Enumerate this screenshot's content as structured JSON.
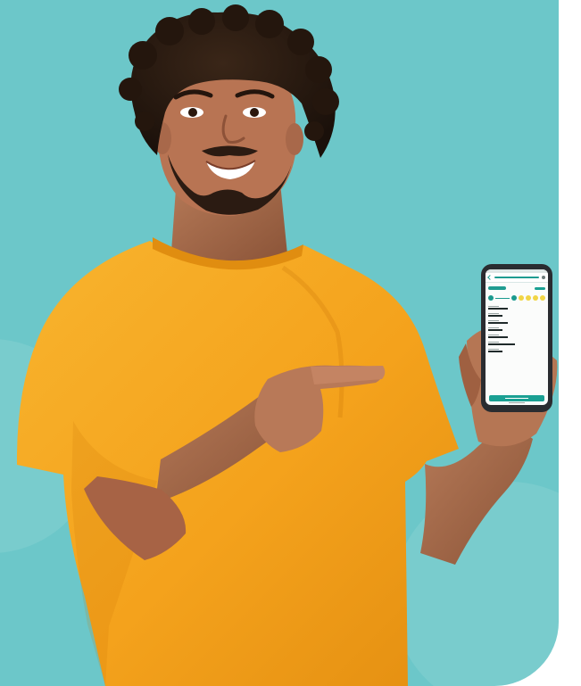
{
  "image": {
    "background_color": "#6cc7c9",
    "page_color": "#ffffff",
    "shirt_color": "#f5a623",
    "skin_color": "#a96b4d",
    "hair_color": "#2a1a10",
    "phone_frame_color": "#2a2c30",
    "phone_accent_color": "#1f9c91",
    "phone_step_color": "#f1d545"
  },
  "icons": {
    "phone_back": "back-arrow-icon",
    "phone_settings": "gear-icon"
  }
}
